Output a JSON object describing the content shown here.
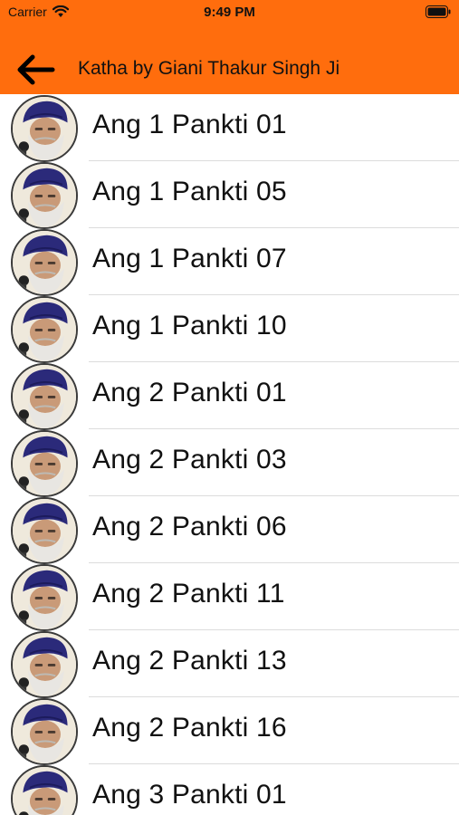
{
  "status_bar": {
    "carrier": "Carrier",
    "time": "9:49 PM",
    "wifi_icon": "wifi-icon",
    "battery_icon": "battery-icon"
  },
  "nav": {
    "back_icon": "arrow-left-icon",
    "title": "Katha by Giani Thakur Singh Ji"
  },
  "colors": {
    "header_bg": "#ff6d0d",
    "separator": "#dcdcdc",
    "turban": "#2b2a7a"
  },
  "list": {
    "items": [
      {
        "label": "Ang 1 Pankti 01"
      },
      {
        "label": "Ang 1 Pankti 05"
      },
      {
        "label": "Ang 1 Pankti 07"
      },
      {
        "label": "Ang 1 Pankti 10"
      },
      {
        "label": "Ang 2 Pankti 01"
      },
      {
        "label": "Ang 2 Pankti 03"
      },
      {
        "label": "Ang 2 Pankti 06"
      },
      {
        "label": "Ang 2 Pankti 11"
      },
      {
        "label": "Ang 2 Pankti 13"
      },
      {
        "label": "Ang 2 Pankti 16"
      },
      {
        "label": "Ang 3 Pankti 01"
      }
    ]
  }
}
